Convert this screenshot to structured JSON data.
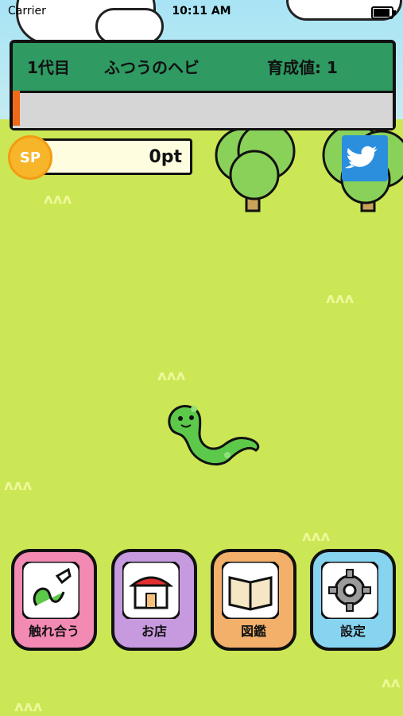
{
  "status_bar": {
    "carrier": "Carrier",
    "time": "10:11 AM",
    "battery_level": 0.95
  },
  "header": {
    "generation": "1代目",
    "type": "ふつうのヘビ",
    "growth_label": "育成値",
    "growth_separator": ": ",
    "growth_value": "1",
    "progress": 0.02
  },
  "sp": {
    "badge": "SP",
    "value": "0pt"
  },
  "buttons": [
    {
      "label": "触れ合う",
      "color": "#f38ab4",
      "icon": "snake-hand-icon"
    },
    {
      "label": "お店",
      "color": "#c79ae0",
      "icon": "shop-icon"
    },
    {
      "label": "図鑑",
      "color": "#f2b06a",
      "icon": "book-icon"
    },
    {
      "label": "設定",
      "color": "#87d4f1",
      "icon": "gear-icon"
    }
  ],
  "colors": {
    "header_bg": "#2f9a62",
    "progress_fill": "#f06a1a",
    "ground": "#cbe756",
    "snake": "#5cc94a",
    "twitter": "#2b8fde"
  },
  "icons": {
    "twitter": "twitter-bird-icon",
    "sp": "sp-coin-icon"
  }
}
